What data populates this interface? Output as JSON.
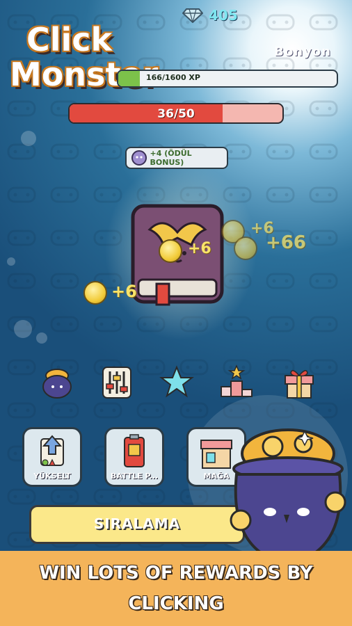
{
  "logo": {
    "line1": "Click",
    "line2": "Monster"
  },
  "header": {
    "gem_icon": "diamond-icon",
    "gems": "405",
    "player_name": "Bonyon"
  },
  "xp": {
    "text": "166/1600 XP",
    "progress": 0.1
  },
  "hp": {
    "text": "36/50",
    "progress": 0.72
  },
  "bonus": {
    "text": "+4 (ÖDÜL BONUS)"
  },
  "floating": {
    "plus_small": "+6",
    "plus_big": "+66"
  },
  "dock": {
    "items": [
      "pot-icon",
      "sliders-icon",
      "star-icon",
      "podium-icon",
      "gift-icon"
    ]
  },
  "menu": {
    "upgrade_label": "YÜKSELT",
    "battle_label": "BATTLE P...",
    "shop_label": "MAĞA"
  },
  "ranking": {
    "label": "SIRALAMA"
  },
  "banner": {
    "text": "WIN LOTS OF REWARDS BY CLICKING"
  },
  "colors": {
    "hp": "#e24a3f",
    "xp": "#7cc24a",
    "banner": "#f4b45a",
    "gem": "#7fe7f0"
  }
}
